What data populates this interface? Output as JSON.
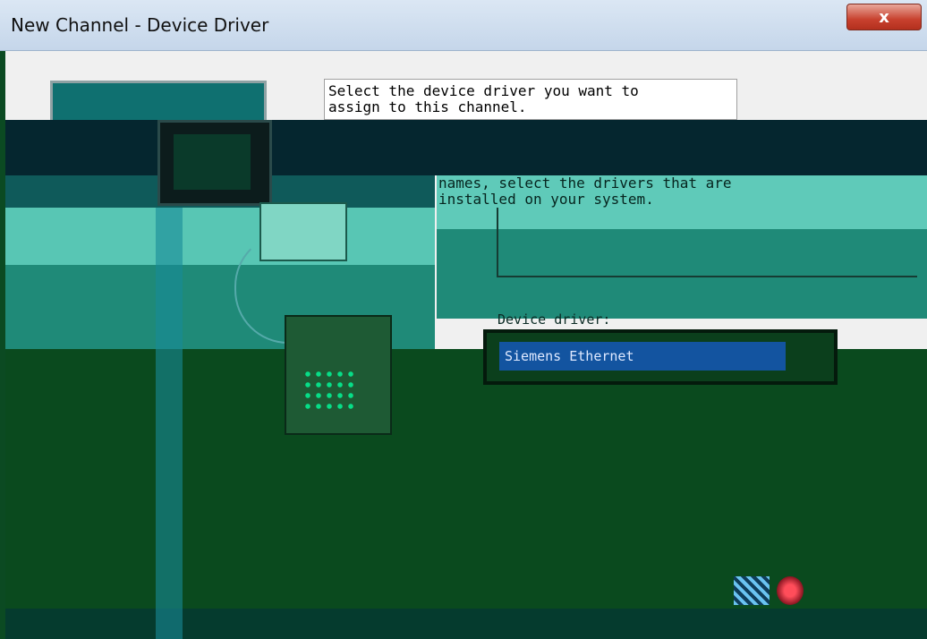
{
  "window": {
    "title": "New Channel - Device Driver",
    "close_label": "x"
  },
  "instructions": {
    "line1": "Select the device driver you want to",
    "line2": "assign to this channel.",
    "line3": "names, select the drivers that are",
    "line4": "installed on your system."
  },
  "driver_list": {
    "label": "Device driver:",
    "selected": "Siemens Ethernet"
  },
  "colors": {
    "titlebar": "#c5d6ea",
    "close": "#c8412e",
    "selection": "#1354a0"
  },
  "icons": {
    "illustration": "computer-network-illustration",
    "help": "help-icon"
  }
}
